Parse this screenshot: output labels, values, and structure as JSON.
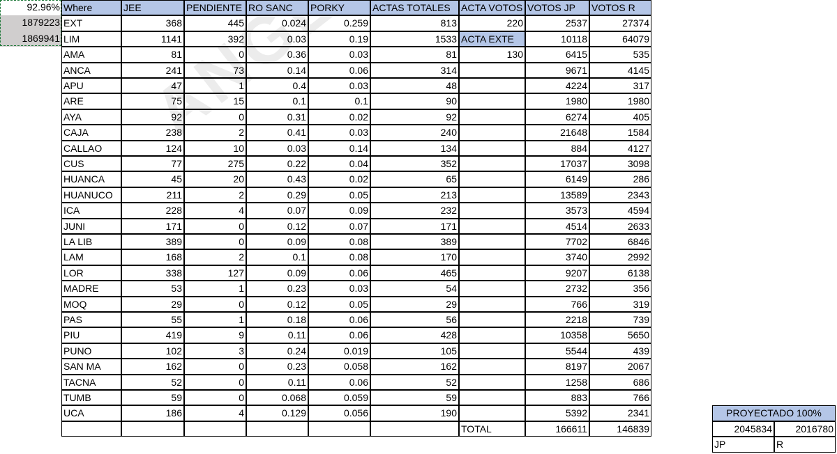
{
  "corner": {
    "pct": "92.96%",
    "n1": "1879223",
    "n2": "1869941"
  },
  "headers": [
    "Where",
    "JEE",
    "PENDIENTE",
    "RO SANC",
    "PORKY",
    "ACTAS TOTALES",
    "ACTA VOTOS",
    "VOTOS JP",
    "VOTOS R"
  ],
  "rows": [
    [
      "EXT",
      "368",
      "445",
      "0.024",
      "0.259",
      "813",
      "220",
      "2537",
      "27374"
    ],
    [
      "LIM",
      "1141",
      "392",
      "0.03",
      "0.19",
      "1533",
      "ACTA EXTE",
      "10118",
      "64079"
    ],
    [
      "AMA",
      "81",
      "0",
      "0.36",
      "0.03",
      "81",
      "130",
      "6415",
      "535"
    ],
    [
      "ANCA",
      "241",
      "73",
      "0.14",
      "0.06",
      "314",
      "",
      "9671",
      "4145"
    ],
    [
      "APU",
      "47",
      "1",
      "0.4",
      "0.03",
      "48",
      "",
      "4224",
      "317"
    ],
    [
      "ARE",
      "75",
      "15",
      "0.1",
      "0.1",
      "90",
      "",
      "1980",
      "1980"
    ],
    [
      "AYA",
      "92",
      "0",
      "0.31",
      "0.02",
      "92",
      "",
      "6274",
      "405"
    ],
    [
      "CAJA",
      "238",
      "2",
      "0.41",
      "0.03",
      "240",
      "",
      "21648",
      "1584"
    ],
    [
      "CALLAO",
      "124",
      "10",
      "0.03",
      "0.14",
      "134",
      "",
      "884",
      "4127"
    ],
    [
      "CUS",
      "77",
      "275",
      "0.22",
      "0.04",
      "352",
      "",
      "17037",
      "3098"
    ],
    [
      "HUANCA",
      "45",
      "20",
      "0.43",
      "0.02",
      "65",
      "",
      "6149",
      "286"
    ],
    [
      "HUANUCO",
      "211",
      "2",
      "0.29",
      "0.05",
      "213",
      "",
      "13589",
      "2343"
    ],
    [
      "ICA",
      "228",
      "4",
      "0.07",
      "0.09",
      "232",
      "",
      "3573",
      "4594"
    ],
    [
      "JUNI",
      "171",
      "0",
      "0.12",
      "0.07",
      "171",
      "",
      "4514",
      "2633"
    ],
    [
      "LA LIB",
      "389",
      "0",
      "0.09",
      "0.08",
      "389",
      "",
      "7702",
      "6846"
    ],
    [
      "LAM",
      "168",
      "2",
      "0.1",
      "0.08",
      "170",
      "",
      "3740",
      "2992"
    ],
    [
      "LOR",
      "338",
      "127",
      "0.09",
      "0.06",
      "465",
      "",
      "9207",
      "6138"
    ],
    [
      "MADRE",
      "53",
      "1",
      "0.23",
      "0.03",
      "54",
      "",
      "2732",
      "356"
    ],
    [
      "MOQ",
      "29",
      "0",
      "0.12",
      "0.05",
      "29",
      "",
      "766",
      "319"
    ],
    [
      "PAS",
      "55",
      "1",
      "0.18",
      "0.06",
      "56",
      "",
      "2218",
      "739"
    ],
    [
      "PIU",
      "419",
      "9",
      "0.11",
      "0.06",
      "428",
      "",
      "10358",
      "5650"
    ],
    [
      "PUNO",
      "102",
      "3",
      "0.24",
      "0.019",
      "105",
      "",
      "5544",
      "439"
    ],
    [
      "SAN MA",
      "162",
      "0",
      "0.23",
      "0.058",
      "162",
      "",
      "8197",
      "2067"
    ],
    [
      "TACNA",
      "52",
      "0",
      "0.11",
      "0.06",
      "52",
      "",
      "1258",
      "686"
    ],
    [
      "TUMB",
      "59",
      "0",
      "0.068",
      "0.059",
      "59",
      "",
      "883",
      "766"
    ],
    [
      "UCA",
      "186",
      "4",
      "0.129",
      "0.056",
      "190",
      "",
      "5392",
      "2341"
    ]
  ],
  "total": {
    "label": "TOTAL",
    "jp": "166611",
    "r": "146839"
  },
  "projection": {
    "title": "PROYECTADO 100%",
    "jp_value": "2045834",
    "r_value": "2016780",
    "jp_label": "JP",
    "r_label": "R"
  },
  "watermark": "ANGELLO_BD",
  "colors": {
    "header_fill": "#b4c6e7",
    "selected_fill": "#d0cece",
    "copy_marquee": "#1f7a3a"
  }
}
